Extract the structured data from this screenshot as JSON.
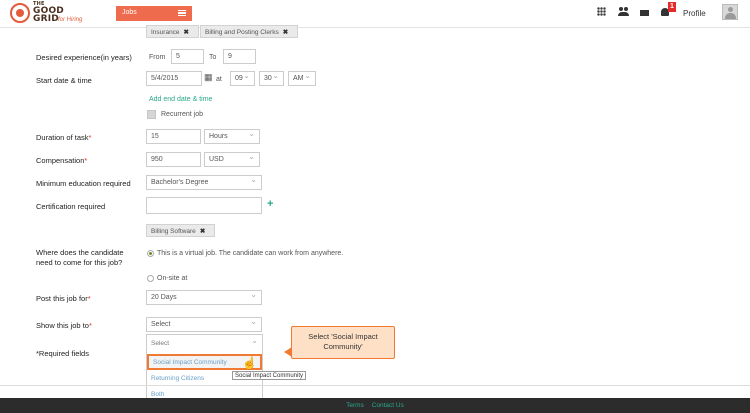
{
  "header": {
    "logo_line1": "THE",
    "logo_line2": "GOOD",
    "logo_line3": "GRID",
    "logo_sub": "for Hiring",
    "jobs_tab": "Jobs",
    "notification_count": "1",
    "profile_label": "Profile",
    "icons": [
      "grid-icon",
      "users-icon",
      "mail-icon",
      "bell-icon",
      "user-avatar"
    ]
  },
  "top_tags": [
    "Insurance",
    "Billing and Posting Clerks"
  ],
  "experience": {
    "label": "Desired experience(in years)",
    "from_label": "From",
    "from_value": "5",
    "to_label": "To",
    "to_value": "9"
  },
  "start": {
    "label": "Start date & time",
    "date": "5/4/2015",
    "at_label": "at",
    "hour": "09",
    "minute": "30",
    "ampm": "AM",
    "add_end_link": "Add end date & time",
    "recurrent_label": "Recurrent job"
  },
  "duration": {
    "label": "Duration of task",
    "value": "15",
    "unit": "Hours"
  },
  "compensation": {
    "label": "Compensation",
    "value": "950",
    "currency": "USD"
  },
  "education": {
    "label": "Minimum education required",
    "value": "Bachelor's Degree"
  },
  "certification": {
    "label": "Certification required",
    "value": "",
    "tag": "Billing Software"
  },
  "candidate": {
    "label_line1": "Where does the candidate",
    "label_line2": "need to come for this job?",
    "option_virtual": "This is a virtual job. The candidate can work from anywhere.",
    "option_onsite": "On-site at"
  },
  "post_for": {
    "label": "Post this job for",
    "value": "20 Days"
  },
  "show_to": {
    "label": "Show this job to",
    "value": "Select",
    "options": [
      "Select",
      "Social Impact Community",
      "Returning Citizens",
      "Both"
    ],
    "hover_tooltip": "Social Impact Community"
  },
  "required_fields_note": "*Required fields",
  "callout": {
    "text": "Select 'Social Impact Community'"
  },
  "footer": {
    "terms": "Terms",
    "contact": "Contact Us"
  }
}
